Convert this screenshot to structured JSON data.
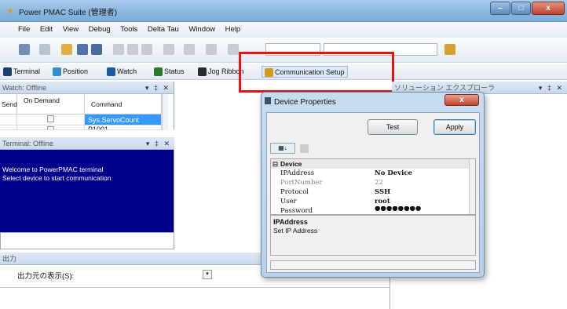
{
  "window": {
    "title": "Power PMAC Suite (管理者)",
    "buttons": [
      "–",
      "□",
      "x"
    ]
  },
  "menu": [
    "File",
    "Edit",
    "View",
    "Debug",
    "Tools",
    "Delta Tau",
    "Window",
    "Help"
  ],
  "toolbar2": [
    {
      "label": "Terminal",
      "icon": "terminal-icon",
      "color": "#1b3e6f"
    },
    {
      "label": "Position",
      "icon": "position-icon",
      "color": "#2f8fcf"
    },
    {
      "label": "Watch",
      "icon": "watch-icon",
      "color": "#1a5aa0"
    },
    {
      "label": "Status",
      "icon": "status-icon",
      "color": "#2b7a2b"
    },
    {
      "label": "Jog Ribbon",
      "icon": "jog-icon",
      "color": "#2a2a2a"
    },
    {
      "label": "Communication Setup",
      "icon": "communication-icon",
      "color": "#d49a18"
    }
  ],
  "watch": {
    "title": "Watch: Offline",
    "columns": [
      "Send",
      "On Demand",
      "Command"
    ],
    "rows": [
      {
        "command": "Sys.ServoCount",
        "selected": true
      },
      {
        "command": "P1001",
        "selected": false
      }
    ]
  },
  "terminal": {
    "title": "Terminal: Offline",
    "lines": [
      "Welcome to PowerPMAC terminal",
      "Select device to start communication"
    ]
  },
  "output": {
    "title": "出力",
    "show_label": "出力元の表示(S):"
  },
  "solution": {
    "title": "ソリューション エクスプローラ"
  },
  "dialog": {
    "title": "Device Properties",
    "close": "x",
    "test_label": "Test",
    "apply_label": "Apply",
    "category": "Device",
    "properties": [
      {
        "key": "IPAddress",
        "value": "No Device",
        "dim": false
      },
      {
        "key": "PortNumber",
        "value": "22",
        "dim": true
      },
      {
        "key": "Protocol",
        "value": "SSH",
        "dim": false
      },
      {
        "key": "User",
        "value": "root",
        "dim": false
      },
      {
        "key": "Password",
        "value": "●●●●●●●●",
        "dim": false
      }
    ],
    "desc_title": "IPAddress",
    "desc_text": "Set IP Address"
  },
  "colors": {
    "highlight": "#ee1111",
    "terminal_bg": "#00008b",
    "selected_row": "#3399ff"
  }
}
